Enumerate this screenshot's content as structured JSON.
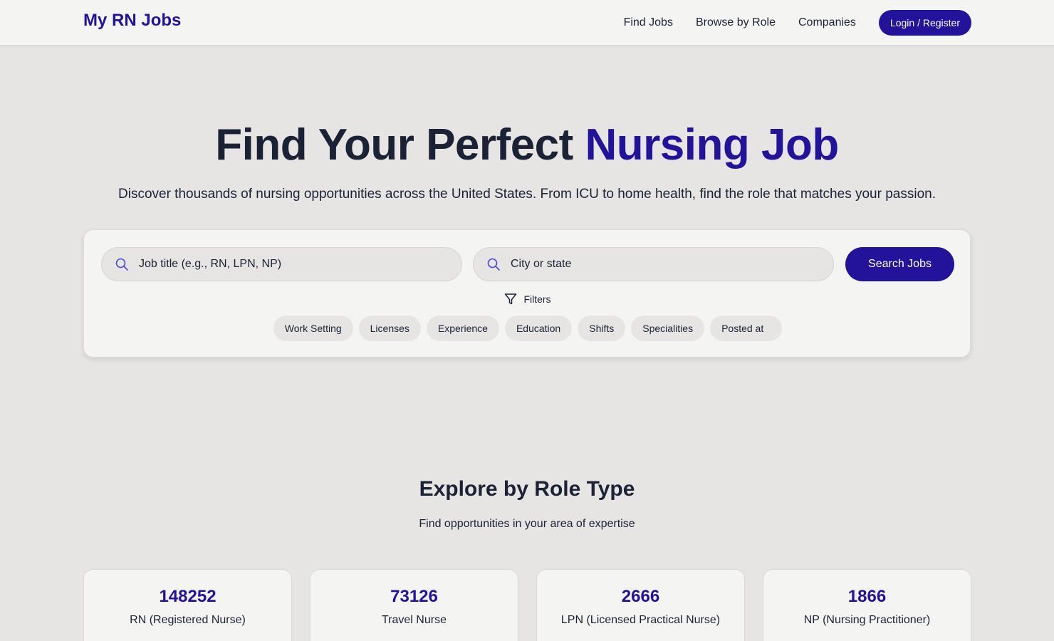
{
  "header": {
    "logo": "My RN Jobs",
    "nav": [
      "Find Jobs",
      "Browse by Role",
      "Companies"
    ],
    "login_label": "Login / Register"
  },
  "hero": {
    "title_main": "Find Your Perfect ",
    "title_accent": "Nursing Job",
    "subtitle": "Discover thousands of nursing opportunities across the United States. From ICU to home health, find the role that matches your passion."
  },
  "search": {
    "job_placeholder": "Job title (e.g., RN, LPN, NP)",
    "location_placeholder": "City or state",
    "button_label": "Search Jobs",
    "filters_label": "Filters",
    "chips": [
      "Work Setting",
      "Licenses",
      "Experience",
      "Education",
      "Shifts",
      "Specialities",
      "Posted at"
    ]
  },
  "explore": {
    "title": "Explore by Role Type",
    "subtitle": "Find opportunities in your area of expertise",
    "roles": [
      {
        "count": "148252",
        "name": "RN (Registered Nurse)"
      },
      {
        "count": "73126",
        "name": "Travel Nurse"
      },
      {
        "count": "2666",
        "name": "LPN (Licensed Practical Nurse)"
      },
      {
        "count": "1866",
        "name": "NP (Nursing Practitioner)"
      }
    ]
  },
  "colors": {
    "brand": "#23139a",
    "text": "#1c2235",
    "background": "#e6e5e4",
    "surface": "#f4f4f3"
  }
}
